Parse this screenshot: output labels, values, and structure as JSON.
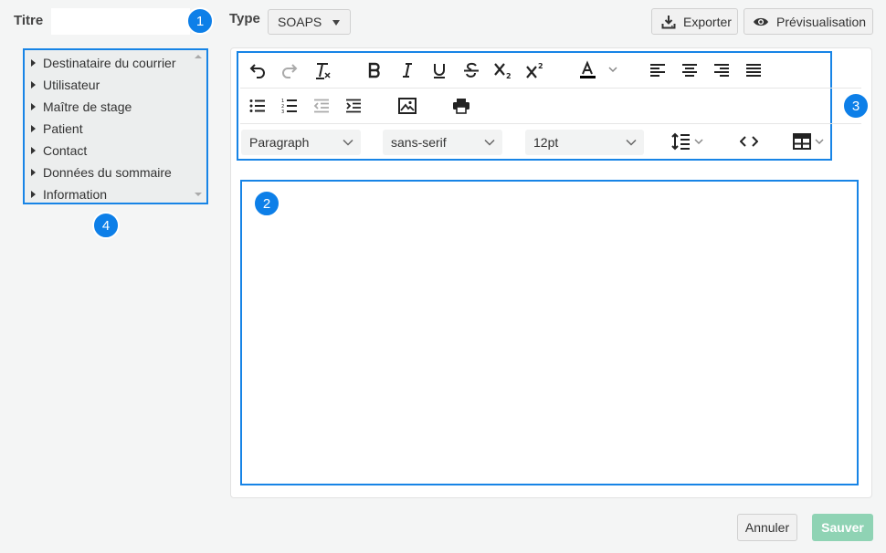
{
  "header": {
    "title_label": "Titre",
    "title_value": "",
    "type_label": "Type",
    "type_value": "SOAPS",
    "export_label": "Exporter",
    "preview_label": "Prévisualisation"
  },
  "badges": [
    "1",
    "2",
    "3",
    "4"
  ],
  "variables": {
    "items": [
      "Destinataire du courrier",
      "Utilisateur",
      "Maître de stage",
      "Patient",
      "Contact",
      "Données du sommaire",
      "Information"
    ]
  },
  "toolbar": {
    "block_format": "Paragraph",
    "font_family": "sans-serif",
    "font_size": "12pt",
    "text_color": "#000000"
  },
  "footer": {
    "cancel_label": "Annuler",
    "save_label": "Sauver"
  },
  "colors": {
    "accent": "#1784e6",
    "badge": "#0d7fe8",
    "save": "#8fd3b4"
  }
}
